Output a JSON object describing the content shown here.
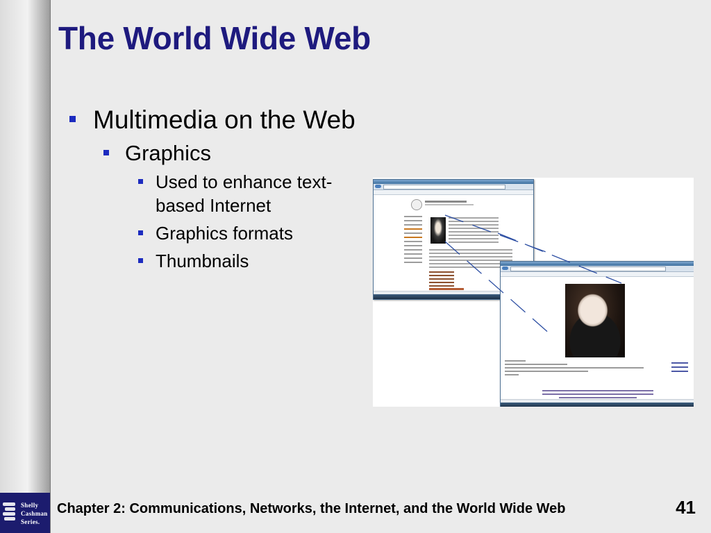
{
  "slide": {
    "title": "The World Wide Web",
    "page_number": "41",
    "footer": "Chapter 2: Communications, Networks, the Internet, and the World Wide Web"
  },
  "logo": {
    "lines": [
      "Shelly",
      "Cashman",
      "Series."
    ]
  },
  "bullets": {
    "level1": "Multimedia on the Web",
    "level2": "Graphics",
    "level3": [
      {
        "line1": "Used to enhance text-",
        "line2": "based Internet"
      },
      {
        "line1": "Graphics formats"
      },
      {
        "line1": "Thumbnails"
      }
    ]
  },
  "colors": {
    "title": "#1e1a7e",
    "bullet": "#1c2bbf",
    "logo_bg": "#1c1c6e",
    "thumbnail_link_line": "#2d4fa3"
  },
  "illustration": {
    "windows": [
      "browser-window-thumbnail-page",
      "browser-window-full-image"
    ]
  }
}
